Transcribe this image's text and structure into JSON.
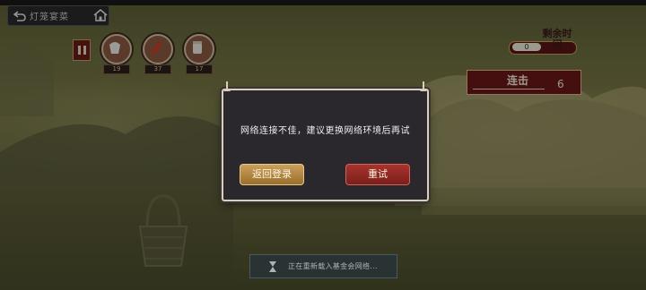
{
  "topbar": {
    "back_label": "灯笼宴菜"
  },
  "hud": {
    "ingredients": [
      {
        "name": "bowl",
        "count": "19"
      },
      {
        "name": "chili",
        "count": "37"
      },
      {
        "name": "cup",
        "count": "17"
      }
    ],
    "timer": {
      "title": "剩余时间",
      "value": "0"
    },
    "combo": {
      "title": "连击",
      "value": "6"
    }
  },
  "dialog": {
    "message": "网络连接不佳，建议更换网络环境后再试",
    "return_label": "返回登录",
    "retry_label": "重试"
  },
  "loading": {
    "text": "正在重新载入基金会网络..."
  },
  "colors": {
    "retry": "#a8332c",
    "return": "#caa05c",
    "dialog_bg": "#2a272d"
  }
}
